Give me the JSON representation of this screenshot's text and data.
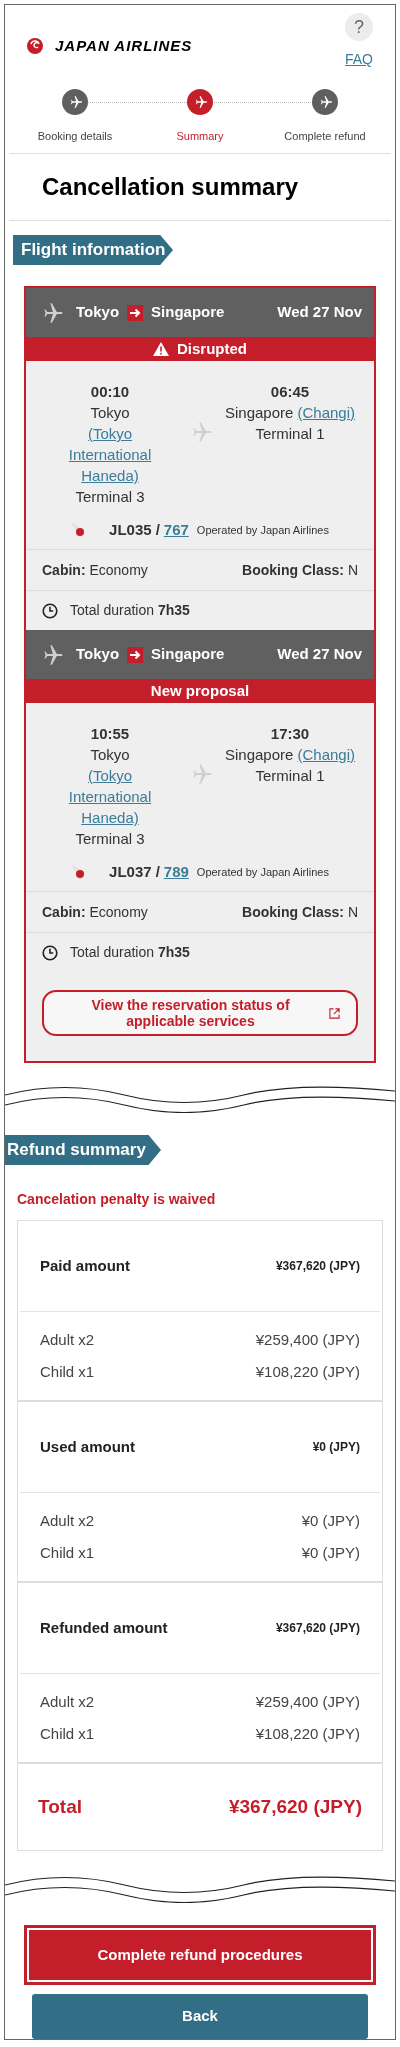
{
  "header": {
    "logo_text": "JAPAN AIRLINES",
    "help": "?",
    "faq_link": "FAQ"
  },
  "steps": [
    {
      "label": "Booking details",
      "selected": false
    },
    {
      "label": "Summary",
      "selected": true
    },
    {
      "label": "Complete refund",
      "selected": false
    }
  ],
  "title": "Cancellation summary",
  "flight_section": {
    "label": "Flight information",
    "segments": [
      {
        "from": "Tokyo",
        "to": "Singapore",
        "date": "Wed 27 Nov",
        "status": "Disrupted",
        "kind": "disrupted",
        "departure": {
          "time": "00:10",
          "city": "Tokyo",
          "airport_link": "(Tokyo International Haneda)",
          "terminal": "Terminal 3"
        },
        "arrival": {
          "time": "06:45",
          "city": "Singapore",
          "airport_link": "(Changi)",
          "terminal": "Terminal 1"
        },
        "flight_number": "JL035",
        "separator": "/",
        "aircraft_link": "767",
        "operated_by": "Operated by Japan Airlines",
        "cabin_label": "Cabin:",
        "cabin": "Economy",
        "class_label": "Booking Class:",
        "booking_class": "N",
        "duration_label": "Total duration",
        "duration": "7h35"
      },
      {
        "from": "Tokyo",
        "to": "Singapore",
        "date": "Wed 27 Nov",
        "status": "New proposal",
        "kind": "proposal",
        "departure": {
          "time": "10:55",
          "city": "Tokyo",
          "airport_link": "(Tokyo International Haneda)",
          "terminal": "Terminal 3"
        },
        "arrival": {
          "time": "17:30",
          "city": "Singapore",
          "airport_link": "(Changi)",
          "terminal": "Terminal 1"
        },
        "flight_number": "JL037",
        "separator": "/",
        "aircraft_link": "789",
        "operated_by": "Operated by Japan Airlines",
        "cabin_label": "Cabin:",
        "cabin": "Economy",
        "class_label": "Booking Class:",
        "booking_class": "N",
        "duration_label": "Total duration",
        "duration": "7h35"
      }
    ],
    "services_link": "View the reservation status of applicable services"
  },
  "refund_section": {
    "label": "Refund summary",
    "notice": "Cancelation penalty is waived",
    "groups": [
      {
        "title": "Paid amount",
        "amount": "¥367,620 (JPY)",
        "lines": [
          {
            "label": "Adult x2",
            "amount": "¥259,400 (JPY)"
          },
          {
            "label": "Child x1",
            "amount": "¥108,220 (JPY)"
          }
        ]
      },
      {
        "title": "Used amount",
        "amount": "¥0 (JPY)",
        "lines": [
          {
            "label": "Adult x2",
            "amount": "¥0 (JPY)"
          },
          {
            "label": "Child x1",
            "amount": "¥0 (JPY)"
          }
        ]
      },
      {
        "title": "Refunded amount",
        "amount": "¥367,620 (JPY)",
        "lines": [
          {
            "label": "Adult x2",
            "amount": "¥259,400 (JPY)"
          },
          {
            "label": "Child x1",
            "amount": "¥108,220 (JPY)"
          }
        ]
      }
    ],
    "total": {
      "label": "Total",
      "amount": "¥367,620 (JPY)"
    }
  },
  "buttons": [
    {
      "label": "Complete refund procedures",
      "kind": "primary"
    },
    {
      "label": "Back",
      "kind": "secondary"
    }
  ]
}
